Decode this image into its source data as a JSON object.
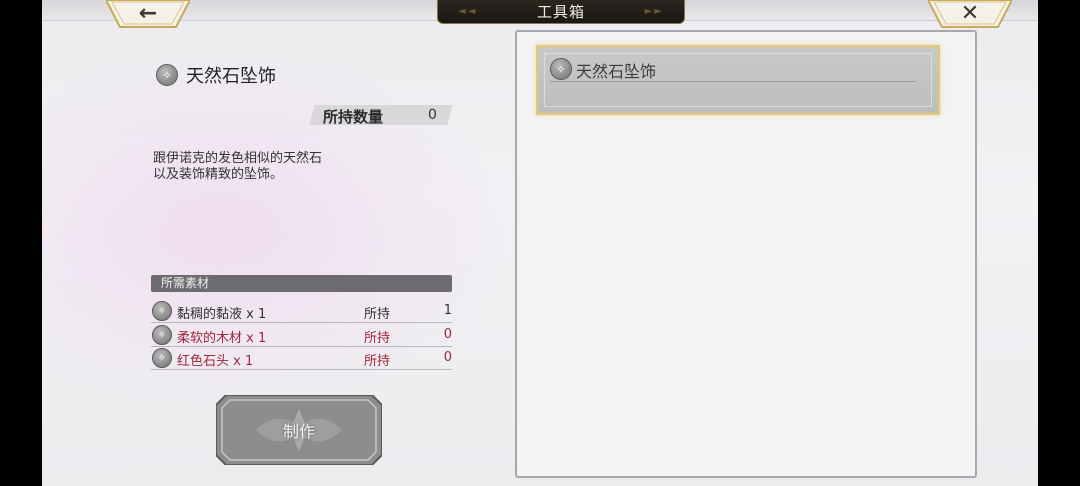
{
  "header": {
    "title": "工具箱",
    "back_icon": "arrow-left-icon",
    "close_icon": "close-icon"
  },
  "detail": {
    "item_name": "天然石坠饰",
    "owned_label": "所持数量",
    "owned_value": "0",
    "description": "跟伊诺克的发色相似的天然石\n以及装饰精致的坠饰。"
  },
  "materials": {
    "header": "所需素材",
    "rows": [
      {
        "name": "黏稠的黏液 x 1",
        "owned_label": "所持",
        "count": "1",
        "sufficient": true
      },
      {
        "name": "柔软的木材 x 1",
        "owned_label": "所持",
        "count": "0",
        "sufficient": false
      },
      {
        "name": "红色石头 x 1",
        "owned_label": "所持",
        "count": "0",
        "sufficient": false
      }
    ]
  },
  "craft_button": {
    "label": "制作"
  },
  "item_list": {
    "items": [
      {
        "name": "天然石坠饰",
        "selected": true
      }
    ]
  },
  "colors": {
    "selection_border": "#e9c670",
    "insufficient_text": "#a0283c",
    "title_plate": "#1a1612"
  }
}
